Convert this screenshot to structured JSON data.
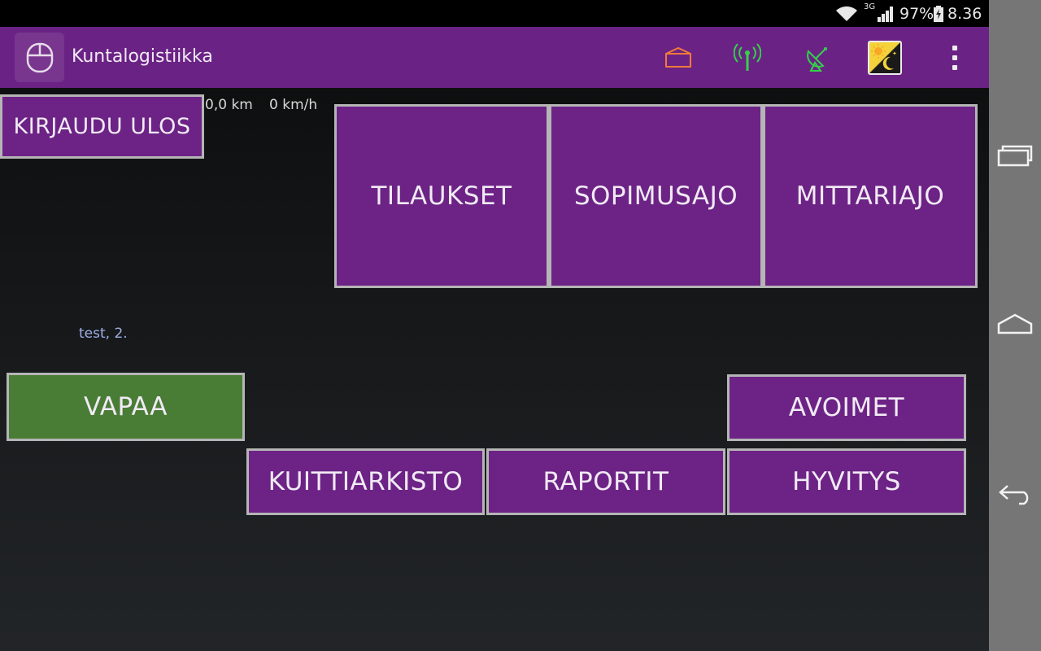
{
  "status_bar": {
    "network": "3G",
    "battery": "97%",
    "time": "8.36",
    "icons": [
      "wifi-icon",
      "cell-signal-icon",
      "battery-icon"
    ]
  },
  "action_bar": {
    "title": "Kuntalogistiikka",
    "icons": [
      "mouse-icon",
      "envelope-icon",
      "antenna-icon",
      "satellite-dish-icon",
      "day-night-icon",
      "overflow-menu-icon"
    ],
    "colors": {
      "background": "#6a2385",
      "envelope": "#f07a3a",
      "antenna": "#35d14a",
      "satellite": "#35d14a"
    }
  },
  "trip": {
    "distance": "0,0 km",
    "speed": "0 km/h"
  },
  "user": "test, 2.",
  "buttons": {
    "logout": "KIRJAUDU ULOS",
    "tilaukset": "TILAUKSET",
    "sopimusajo": "SOPIMUSAJO",
    "mittariajo": "MITTARIAJO",
    "vapaa": "VAPAA",
    "avoimet": "AVOIMET",
    "kuittiarkisto": "KUITTIARKISTO",
    "raportit": "RAPORTIT",
    "hyvitys": "HYVITYS"
  },
  "colors": {
    "button_purple": "#6c2385",
    "button_green": "#497d36",
    "button_border": "#b5b5b5"
  },
  "nav_bar": {
    "icons": [
      "recent-apps-icon",
      "home-icon",
      "back-icon"
    ]
  }
}
